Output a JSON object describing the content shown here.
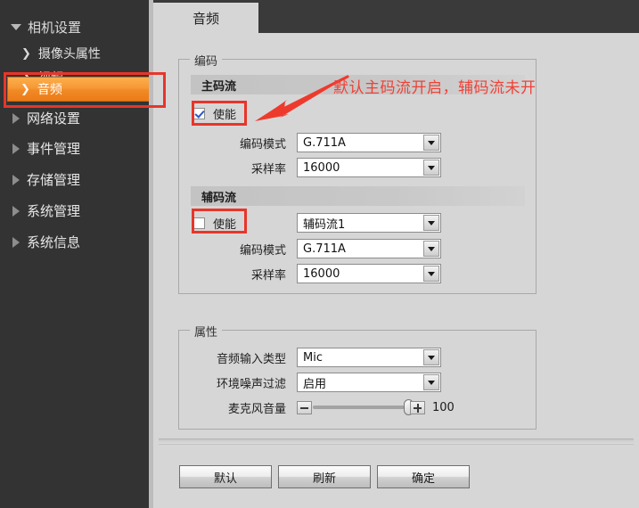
{
  "sidebar": {
    "root": {
      "label": "相机设置",
      "icon": "triangle-down-icon"
    },
    "children": [
      {
        "label": "摄像头属性",
        "icon": "chevron-right-icon",
        "selected": false
      },
      {
        "label": "视频",
        "icon": "chevron-right-icon",
        "selected": false
      },
      {
        "label": "音频",
        "icon": "chevron-right-icon",
        "selected": true
      }
    ],
    "groups": [
      {
        "label": "网络设置",
        "icon": "triangle-right-icon"
      },
      {
        "label": "事件管理",
        "icon": "triangle-right-icon"
      },
      {
        "label": "存储管理",
        "icon": "triangle-right-icon"
      },
      {
        "label": "系统管理",
        "icon": "triangle-right-icon"
      },
      {
        "label": "系统信息",
        "icon": "triangle-right-icon"
      }
    ]
  },
  "tabs": [
    {
      "label": "音频",
      "active": true
    }
  ],
  "encode_group": {
    "legend": "编码",
    "main_stream": {
      "header": "主码流",
      "enable_label": "使能",
      "enable_checked": true,
      "rows": [
        {
          "label": "编码模式",
          "value": "G.711A"
        },
        {
          "label": "采样率",
          "value": "16000"
        }
      ]
    },
    "sub_stream": {
      "header": "辅码流",
      "enable_label": "使能",
      "enable_checked": false,
      "stream_select": "辅码流1",
      "rows": [
        {
          "label": "编码模式",
          "value": "G.711A"
        },
        {
          "label": "采样率",
          "value": "16000"
        }
      ]
    }
  },
  "properties_group": {
    "legend": "属性",
    "rows": [
      {
        "label": "音频输入类型",
        "value": "Mic"
      },
      {
        "label": "环境噪声过滤",
        "value": "启用"
      }
    ],
    "volume": {
      "label": "麦克风音量",
      "value": "100",
      "minus_icon": "minus-icon",
      "plus_icon": "plus-icon"
    }
  },
  "footer": {
    "buttons": [
      {
        "label": "默认"
      },
      {
        "label": "刷新"
      },
      {
        "label": "确定"
      }
    ]
  },
  "annotations": {
    "note_text": "默认主码流开启，辅码流未开",
    "color": "#ef4136"
  }
}
